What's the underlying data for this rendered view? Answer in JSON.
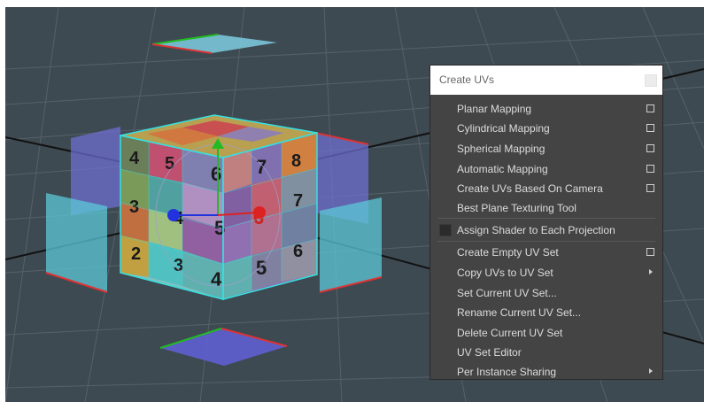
{
  "menu": {
    "title": "Create UVs",
    "items_group1": [
      {
        "label": "Planar Mapping",
        "has_option_box": true
      },
      {
        "label": "Cylindrical Mapping",
        "has_option_box": true
      },
      {
        "label": "Spherical Mapping",
        "has_option_box": true
      },
      {
        "label": "Automatic Mapping",
        "has_option_box": true
      },
      {
        "label": "Create UVs Based On Camera",
        "has_option_box": true
      },
      {
        "label": "Best Plane Texturing Tool",
        "has_option_box": false
      }
    ],
    "checkbox_item": {
      "label": "Assign Shader to Each Projection",
      "checked": false
    },
    "items_group2": [
      {
        "label": "Create Empty UV Set",
        "has_option_box": true
      },
      {
        "label": "Copy UVs to UV Set",
        "has_submenu": true
      },
      {
        "label": "Set Current UV Set..."
      },
      {
        "label": "Rename Current UV Set..."
      },
      {
        "label": "Delete Current UV Set"
      },
      {
        "label": "UV Set Editor"
      },
      {
        "label": "Per Instance Sharing",
        "has_submenu": true
      }
    ]
  },
  "viewport": {
    "background": "#3e4a52",
    "cube_top_numbers": [
      "",
      "",
      ""
    ],
    "cube_front_numbers": [
      "5",
      "6",
      "7",
      "8",
      "4",
      "5",
      "6",
      "7",
      "3",
      "4",
      "5",
      "6",
      "2",
      "3",
      "4",
      "5"
    ],
    "cube_left_numbers": [
      "4",
      "3",
      "2"
    ],
    "cube_side_numbers": [
      "8",
      "7",
      "6"
    ]
  },
  "colors": {
    "menu_bg": "#444444",
    "menu_text": "#dcdcdc",
    "wireframe_cyan": "#35e0e0",
    "manip_red": "#dd2222",
    "manip_green": "#22bb22",
    "manip_blue": "#2233dd"
  }
}
